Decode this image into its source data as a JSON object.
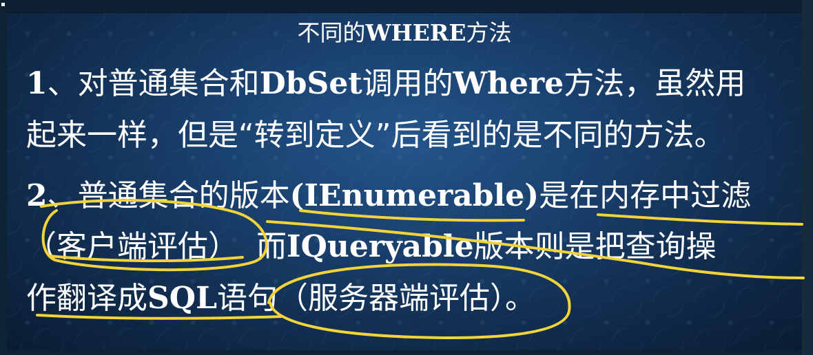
{
  "slide": {
    "title": {
      "prefix": "不同的",
      "bold": "WHERE",
      "suffix": "方法"
    },
    "point1": {
      "line1": {
        "num": "1",
        "t1": "、对普通集合和",
        "b1": "DbSet",
        "t2": "调用的",
        "b2": "Where",
        "t3": "方法，虽然用"
      },
      "line2": "起来一样，但是“转到定义”后看到的是不同的方法。"
    },
    "point2": {
      "line1": {
        "num": "2",
        "t1": "、普通集合的版本",
        "b1": "(IEnumerable)",
        "t2": "是在内存中过滤"
      },
      "line2": {
        "t1": "（客户端评估）",
        "t2": "而",
        "b1": "IQueryable",
        "t3": "版本则是把查询操"
      },
      "line3": {
        "t1": "作翻译成",
        "b1": "SQL",
        "t2": "语句（服务器端评估）。"
      }
    }
  },
  "annotation_color": "#f2d33a"
}
